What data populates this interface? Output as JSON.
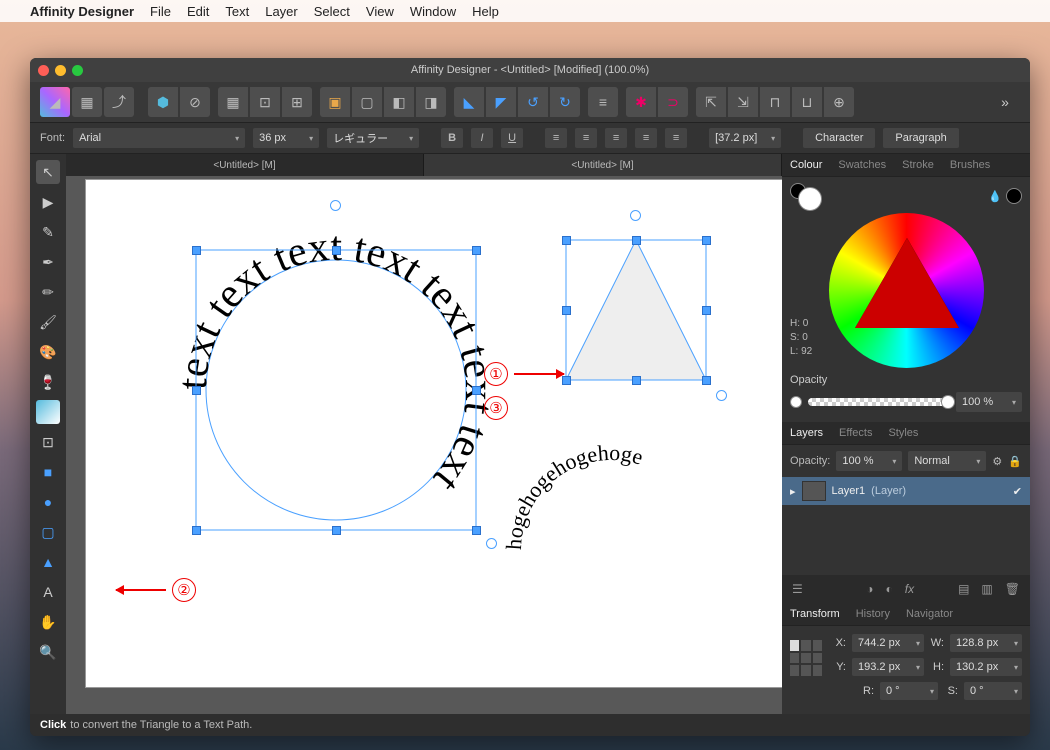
{
  "menubar": {
    "app": "Affinity Designer",
    "items": [
      "File",
      "Edit",
      "Text",
      "Layer",
      "Select",
      "View",
      "Window",
      "Help"
    ]
  },
  "window": {
    "title": "Affinity Designer - <Untitled> [Modified] (100.0%)"
  },
  "optionbar": {
    "font_label": "Font:",
    "font_value": "Arial",
    "size_value": "36 px",
    "weight_value": "レギュラー",
    "leading": "[37.2 px]",
    "character": "Character",
    "paragraph": "Paragraph"
  },
  "doctabs": {
    "a": "<Untitled> [M]",
    "b": "<Untitled> [M]"
  },
  "panels": {
    "colour": {
      "tabs": [
        "Colour",
        "Swatches",
        "Stroke",
        "Brushes"
      ],
      "h": "H: 0",
      "s": "S: 0",
      "l": "L: 92",
      "opacity_label": "Opacity",
      "opacity_value": "100 %"
    },
    "layers": {
      "tabs": [
        "Layers",
        "Effects",
        "Styles"
      ],
      "opacity_label": "Opacity:",
      "opacity_value": "100 %",
      "blend": "Normal",
      "layer_name": "Layer1",
      "layer_suffix": "(Layer)"
    },
    "transform": {
      "tabs": [
        "Transform",
        "History",
        "Navigator"
      ],
      "x_label": "X:",
      "x": "744.2 px",
      "w_label": "W:",
      "w": "128.8 px",
      "y_label": "Y:",
      "y": "193.2 px",
      "h_label": "H:",
      "h": "130.2 px",
      "r_label": "R:",
      "r": "0 °",
      "s_label": "S:",
      "s": "0 °"
    }
  },
  "status": {
    "bold": "Click",
    "rest": "to convert the Triangle to a Text Path."
  },
  "annotations": {
    "a1": "①",
    "a2": "②",
    "a3": "③"
  },
  "canvas": {
    "circle_text": "text text text text text text text",
    "arc_text": "hogehogehogehoge"
  }
}
